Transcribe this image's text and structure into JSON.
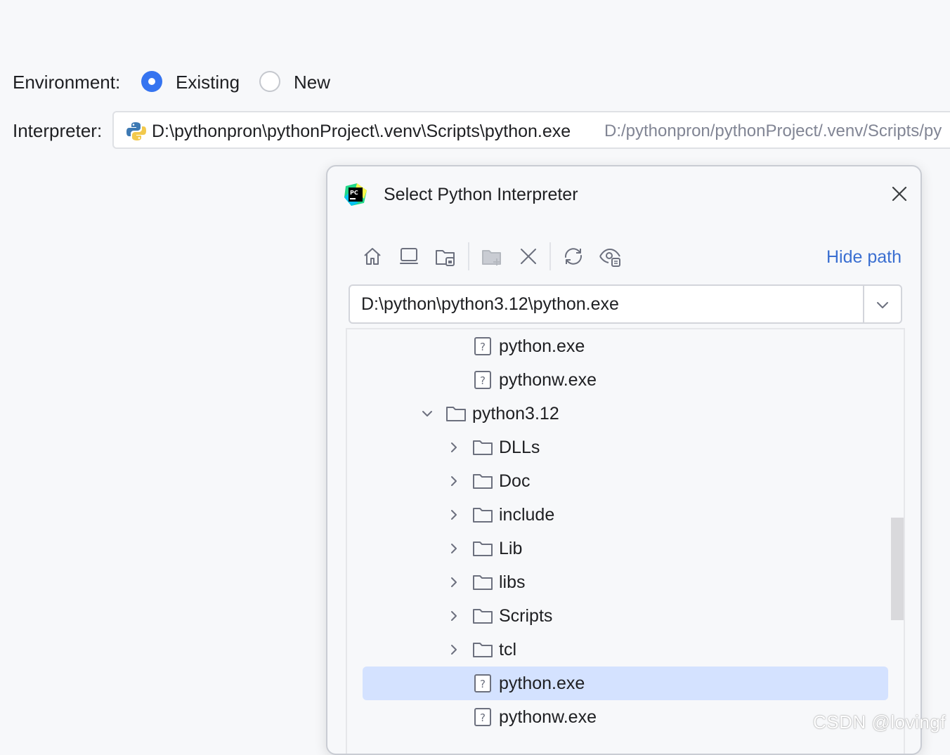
{
  "environment": {
    "label": "Environment:",
    "options": [
      {
        "label": "Existing",
        "selected": true
      },
      {
        "label": "New",
        "selected": false
      }
    ]
  },
  "interpreter": {
    "label": "Interpreter:",
    "value": "D:\\pythonpron\\pythonProject\\.venv\\Scripts\\python.exe",
    "hint": "D:/pythonpron/pythonProject/.venv/Scripts/py"
  },
  "dialog": {
    "title": "Select Python Interpreter",
    "toolbar": {
      "icons": [
        "home-icon",
        "desktop-icon",
        "project-folder-icon",
        "new-folder-icon",
        "delete-icon",
        "refresh-icon",
        "show-hidden-icon"
      ],
      "hide_path_label": "Hide path"
    },
    "path_value": "D:\\python\\python3.12\\python.exe",
    "tree": [
      {
        "label": "python.exe",
        "type": "file",
        "selected": false
      },
      {
        "label": "pythonw.exe",
        "type": "file",
        "selected": false
      },
      {
        "label": "python3.12",
        "type": "folder",
        "expanded": true
      },
      {
        "label": "DLLs",
        "type": "folder",
        "expanded": false
      },
      {
        "label": "Doc",
        "type": "folder",
        "expanded": false
      },
      {
        "label": "include",
        "type": "folder",
        "expanded": false
      },
      {
        "label": "Lib",
        "type": "folder",
        "expanded": false
      },
      {
        "label": "libs",
        "type": "folder",
        "expanded": false
      },
      {
        "label": "Scripts",
        "type": "folder",
        "expanded": false
      },
      {
        "label": "tcl",
        "type": "folder",
        "expanded": false
      },
      {
        "label": "python.exe",
        "type": "file",
        "selected": true
      },
      {
        "label": "pythonw.exe",
        "type": "file",
        "selected": false
      }
    ]
  },
  "watermark": "CSDN @lovingf",
  "colors": {
    "accent": "#3574f0",
    "link": "#3b6fd1",
    "selection": "#d4e2ff",
    "background": "#f7f8fa"
  }
}
